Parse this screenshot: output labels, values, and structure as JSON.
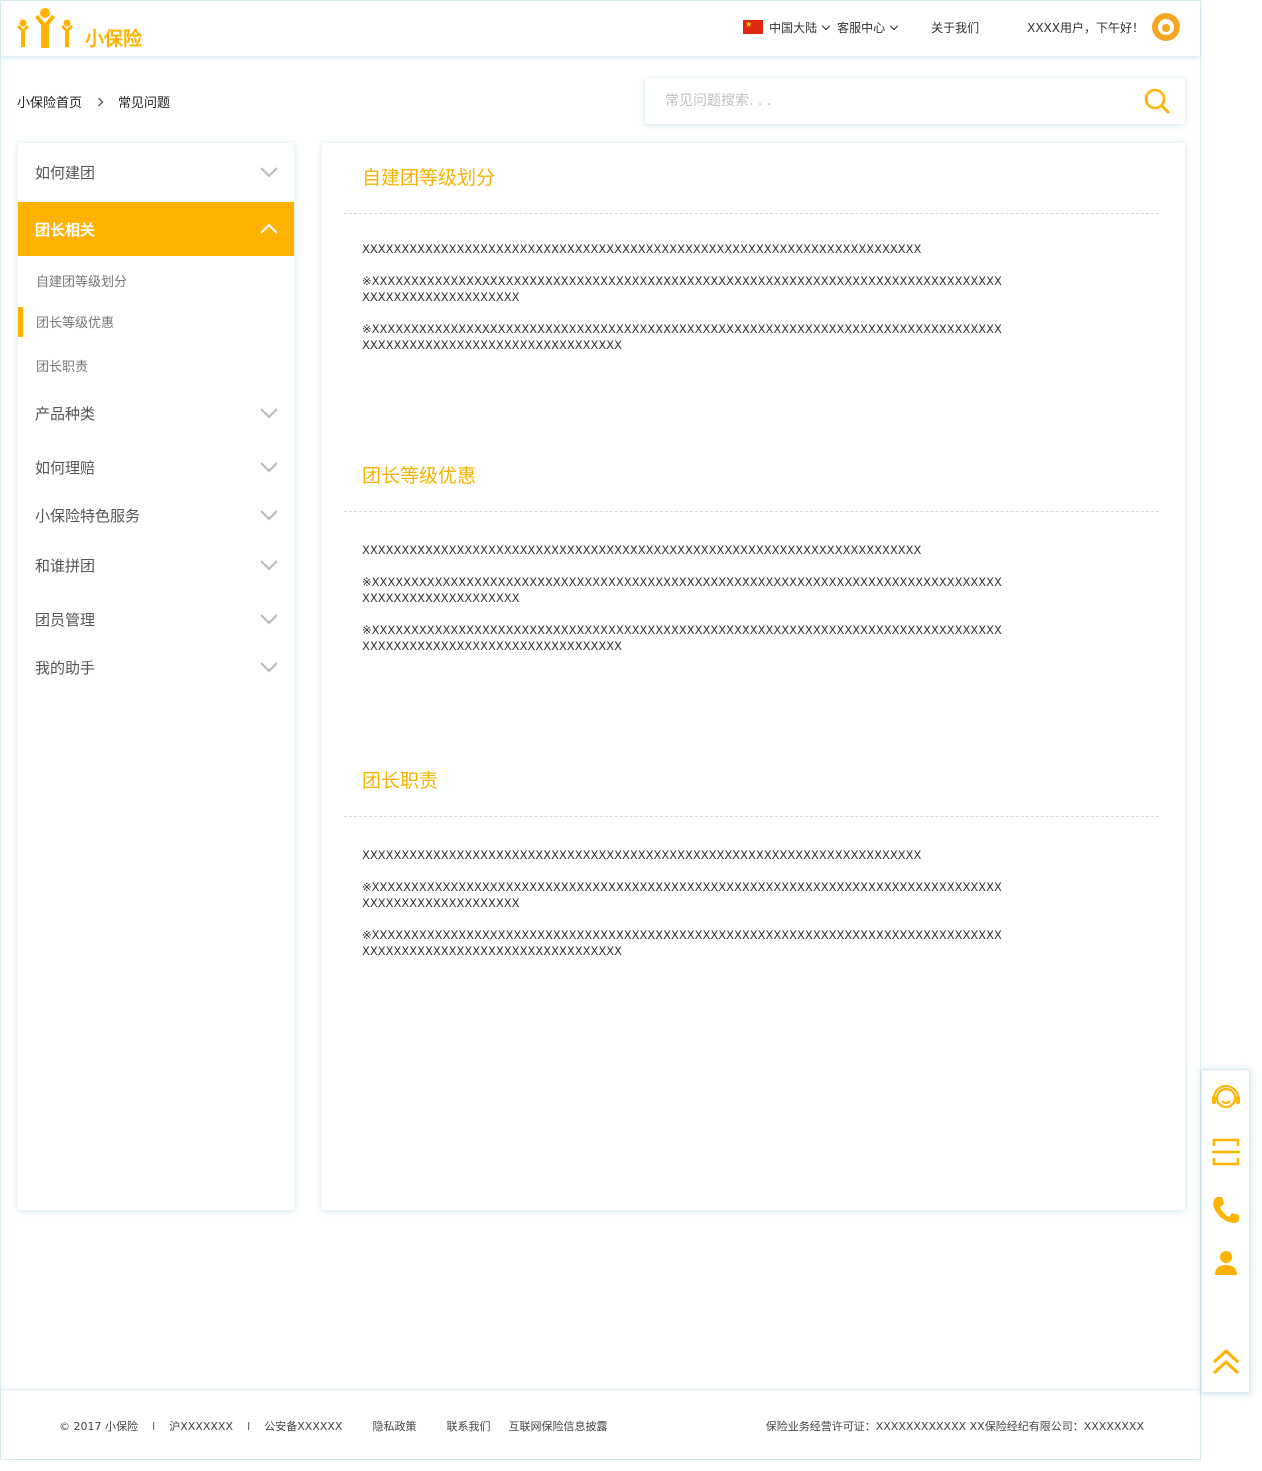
{
  "brand": {
    "name": "小保险",
    "color": "#ffb300"
  },
  "topnav": {
    "region": "中国大陆",
    "service": "客服中心",
    "about": "关于我们",
    "greeting": "XXXX用户，下午好！"
  },
  "breadcrumb": {
    "home": "小保险首页",
    "current": "常见问题"
  },
  "search": {
    "placeholder": "常见问题搜索. . ."
  },
  "sidebar": {
    "categories": [
      {
        "label": "如何建团",
        "expanded": false
      },
      {
        "label": "团长相关",
        "expanded": true,
        "active": true
      },
      {
        "label": "产品种类",
        "expanded": false
      },
      {
        "label": "如何理赔",
        "expanded": false
      },
      {
        "label": "小保险特色服务",
        "expanded": false
      },
      {
        "label": "和谁拼团",
        "expanded": false
      },
      {
        "label": "团员管理",
        "expanded": false
      },
      {
        "label": "我的助手",
        "expanded": false
      }
    ],
    "subitems": [
      {
        "label": "自建团等级划分",
        "current": false
      },
      {
        "label": "团长等级优惠",
        "current": true
      },
      {
        "label": "团长职责",
        "current": false
      }
    ]
  },
  "sections": [
    {
      "title": "自建团等级划分",
      "paragraphs": [
        "XXXXXXXXXXXXXXXXXXXXXXXXXXXXXXXXXXXXXXXXXXXXXXXXXXXXXXXXXXXXXXXXXXXXXXX",
        "※XXXXXXXXXXXXXXXXXXXXXXXXXXXXXXXXXXXXXXXXXXXXXXXXXXXXXXXXXXXXXXXXXXXXXXXXXXXXXXXXXXXXXXXXXXXXXXXXXXXX",
        "※XXXXXXXXXXXXXXXXXXXXXXXXXXXXXXXXXXXXXXXXXXXXXXXXXXXXXXXXXXXXXXXXXXXXXXXXXXXXXXXXXXXXXXXXXXXXXXXXXXXXXXXXXXXXXXXXX"
      ]
    },
    {
      "title": "团长等级优惠",
      "paragraphs": [
        "XXXXXXXXXXXXXXXXXXXXXXXXXXXXXXXXXXXXXXXXXXXXXXXXXXXXXXXXXXXXXXXXXXXXXXX",
        "※XXXXXXXXXXXXXXXXXXXXXXXXXXXXXXXXXXXXXXXXXXXXXXXXXXXXXXXXXXXXXXXXXXXXXXXXXXXXXXXXXXXXXXXXXXXXXXXXXXXX",
        "※XXXXXXXXXXXXXXXXXXXXXXXXXXXXXXXXXXXXXXXXXXXXXXXXXXXXXXXXXXXXXXXXXXXXXXXXXXXXXXXXXXXXXXXXXXXXXXXXXXXXXXXXXXXXXXXXX"
      ]
    },
    {
      "title": "团长职责",
      "paragraphs": [
        "XXXXXXXXXXXXXXXXXXXXXXXXXXXXXXXXXXXXXXXXXXXXXXXXXXXXXXXXXXXXXXXXXXXXXXX",
        "※XXXXXXXXXXXXXXXXXXXXXXXXXXXXXXXXXXXXXXXXXXXXXXXXXXXXXXXXXXXXXXXXXXXXXXXXXXXXXXXXXXXXXXXXXXXXXXXXXXXX",
        "※XXXXXXXXXXXXXXXXXXXXXXXXXXXXXXXXXXXXXXXXXXXXXXXXXXXXXXXXXXXXXXXXXXXXXXXXXXXXXXXXXXXXXXXXXXXXXXXXXXXXXXXXXXXXXXXXX"
      ]
    }
  ],
  "footer": {
    "copyright": "© 2017 小保险",
    "icp": "沪XXXXXXX",
    "police": "公安备XXXXXX",
    "links": [
      "隐私政策",
      "联系我们",
      "互联网保险信息披露"
    ],
    "license": "保险业务经营许可证：XXXXXXXXXXXX XX保险经纪有限公司：XXXXXXXX"
  },
  "floatbar": {
    "icons": [
      "headset-icon",
      "scan-icon",
      "phone-icon",
      "user-icon",
      "back-to-top-icon"
    ]
  }
}
